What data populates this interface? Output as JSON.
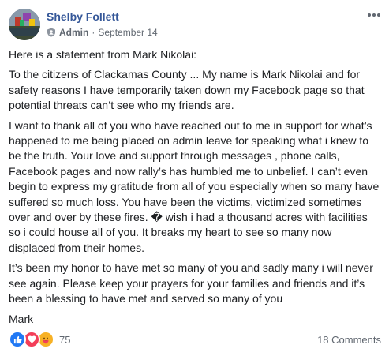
{
  "post": {
    "author": "Shelby Follett",
    "role": "Admin",
    "separator": "·",
    "date": "September 14",
    "paragraphs": [
      "Here is a statement from Mark Nikolai:",
      "To the citizens of Clackamas County ... My name is Mark Nikolai and for safety reasons I have temporarily taken down my Facebook page so that potential threats can’t see who my friends are.",
      "I want to thank all of you who have reached out to me in support for what’s happened to me being placed on admin leave for speaking what i knew to be the truth. Your love and support through messages , phone calls, Facebook pages and now rally’s has humbled me to unbelief. I can’t even begin to express my gratitude from all of you especially when so many have suffered so much loss. You have been the victims, victimized sometimes over and over by these fires. � wish i had a thousand acres with facilities so i could house all of you. It breaks my heart to see so many now displaced from their homes.",
      "It’s been my honor to have met so many of you and sadly many i will never see again. Please keep your prayers for your families and friends and it’s been a blessing to have met and served so many of you",
      "Mark"
    ]
  },
  "footer": {
    "reaction_icons": [
      "like-icon",
      "love-icon",
      "care-icon"
    ],
    "reaction_count": "75",
    "comments": "18 Comments"
  },
  "colors": {
    "author_link": "#365899",
    "meta_text": "#606770",
    "like": "#2078f4",
    "love": "#f33e58",
    "care": "#f7b125"
  }
}
